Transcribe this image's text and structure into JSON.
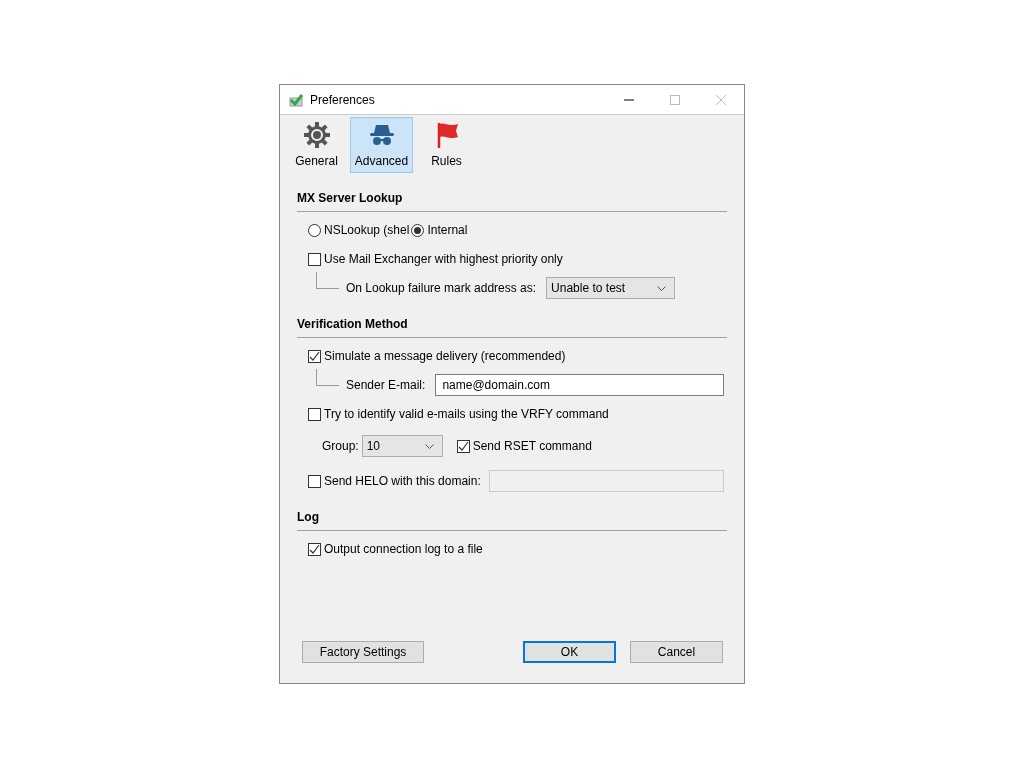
{
  "window": {
    "title": "Preferences"
  },
  "tabs": [
    {
      "label": "General",
      "selected": false,
      "kind": "gear"
    },
    {
      "label": "Advanced",
      "selected": true,
      "kind": "spy"
    },
    {
      "label": "Rules",
      "selected": false,
      "kind": "flag"
    }
  ],
  "sections": [
    {
      "title": "MX Server Lookup",
      "rows": [
        {
          "kind": "radios",
          "options": [
            {
              "label": "NSLookup (shel",
              "selected": false
            },
            {
              "label": "Internal",
              "selected": true
            }
          ]
        },
        {
          "kind": "checkbox",
          "label": "Use Mail Exchanger with highest priority only",
          "checked": false
        },
        {
          "kind": "sub-select",
          "label": "On Lookup failure mark address as:",
          "value": "Unable to test"
        }
      ]
    },
    {
      "title": "Verification Method",
      "rows": [
        {
          "kind": "checkbox",
          "label": "Simulate a message delivery (recommended)",
          "checked": true
        },
        {
          "kind": "sub-field",
          "label": "Sender E-mail:",
          "value": "name@domain.com"
        },
        {
          "kind": "checkbox",
          "label": "Try to identify valid e-mails using the VRFY command",
          "checked": false
        },
        {
          "kind": "group",
          "label": "Group:",
          "value": "10",
          "option": {
            "label": "Send RSET command",
            "checked": true
          }
        },
        {
          "kind": "checkbox-field",
          "label": "Send HELO with this domain:",
          "checked": false,
          "disabled": true
        }
      ]
    },
    {
      "title": "Log",
      "rows": [
        {
          "kind": "checkbox",
          "label": "Output connection log to a file",
          "checked": true
        }
      ]
    }
  ],
  "buttons": [
    {
      "label": "Factory Settings",
      "kind": "left"
    },
    {
      "label": "OK",
      "kind": "default"
    },
    {
      "label": "Cancel",
      "kind": "normal"
    }
  ]
}
